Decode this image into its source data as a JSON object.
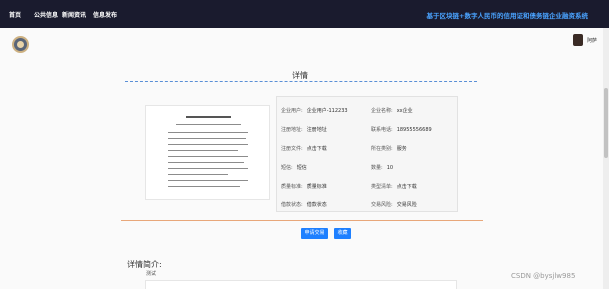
{
  "nav": {
    "items": [
      "首页",
      "公共信息",
      "新闻资讯",
      "信息发布"
    ],
    "site_title": "基于区块链+数字人民币的信用证和债务链企业融资系统"
  },
  "user": {
    "name": "阿萨"
  },
  "detail": {
    "title": "详情",
    "fields": {
      "enterprise_user_label": "企业用户:",
      "enterprise_user_value": "企业用户-112233",
      "enterprise_name_label": "企业名称:",
      "enterprise_name_value": "xx企业",
      "address_label": "注册地址:",
      "address_value": "注册地址",
      "phone_label": "联系电话:",
      "phone_value": "18955556689",
      "file_label": "注册文件:",
      "file_value": "点击下载",
      "category_label": "所在类别:",
      "category_value": "服务",
      "score_label": "短信:",
      "score_value": "短信",
      "count_label": "数量:",
      "count_value": "10",
      "standard_label": "质量标准:",
      "standard_value": "质量标准",
      "form_label": "类型清单:",
      "form_value": "点击下载",
      "loan_status_label": "借款状态:",
      "loan_status_value": "借款状态",
      "risk_label": "交易风险:",
      "risk_value": "交易风险"
    }
  },
  "buttons": {
    "apply": "申请交易",
    "favorite": "收藏"
  },
  "intro": {
    "title": "详情简介:",
    "text": "测试"
  },
  "watermark": "CSDN @bysjlw985",
  "colors": {
    "nav_bg": "#1a1b2e",
    "title_accent": "#4aa3ff",
    "button": "#1e80ff",
    "divider": "#e8a77a"
  }
}
